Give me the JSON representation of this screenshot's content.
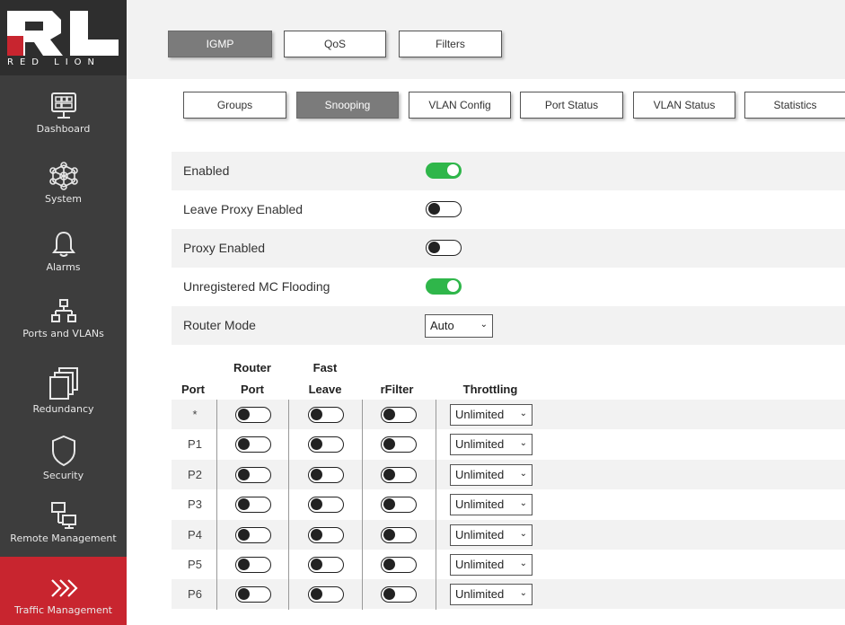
{
  "brand": {
    "logo_text": "RED LION",
    "logo_color": "#c8252f"
  },
  "sidebar": {
    "items": [
      {
        "label": "Dashboard",
        "icon": "dashboard-icon"
      },
      {
        "label": "System",
        "icon": "network-icon"
      },
      {
        "label": "Alarms",
        "icon": "bell-icon"
      },
      {
        "label": "Ports and VLANs",
        "icon": "ports-icon"
      },
      {
        "label": "Redundancy",
        "icon": "redundancy-icon"
      },
      {
        "label": "Security",
        "icon": "shield-icon"
      },
      {
        "label": "Remote Management",
        "icon": "remote-management-icon"
      },
      {
        "label": "Traffic Management",
        "icon": "chevrons-icon",
        "active": true
      }
    ]
  },
  "top_tabs": [
    {
      "label": "IGMP",
      "active": true
    },
    {
      "label": "QoS"
    },
    {
      "label": "Filters"
    }
  ],
  "sub_tabs": [
    {
      "label": "Groups"
    },
    {
      "label": "Snooping",
      "active": true
    },
    {
      "label": "VLAN Config"
    },
    {
      "label": "Port Status"
    },
    {
      "label": "VLAN Status"
    },
    {
      "label": "Statistics"
    }
  ],
  "settings": [
    {
      "label": "Enabled",
      "on": true
    },
    {
      "label": "Leave Proxy Enabled",
      "on": false
    },
    {
      "label": "Proxy Enabled",
      "on": false
    },
    {
      "label": "Unregistered MC Flooding",
      "on": true
    },
    {
      "label": "Router Mode",
      "value": "Auto"
    }
  ],
  "port_table": {
    "headers": {
      "port": "Port",
      "router_port_1": "Router",
      "router_port_2": "Port",
      "fast_leave_1": "Fast",
      "fast_leave_2": "Leave",
      "rfilter": "rFilter",
      "throttling": "Throttling"
    },
    "rows": [
      {
        "port": "*",
        "throttling": "Unlimited"
      },
      {
        "port": "P1",
        "throttling": "Unlimited"
      },
      {
        "port": "P2",
        "throttling": "Unlimited"
      },
      {
        "port": "P3",
        "throttling": "Unlimited"
      },
      {
        "port": "P4",
        "throttling": "Unlimited"
      },
      {
        "port": "P5",
        "throttling": "Unlimited"
      },
      {
        "port": "P6",
        "throttling": "Unlimited"
      }
    ]
  },
  "colors": {
    "accent_red": "#c8252f",
    "toggle_on": "#2fb64a",
    "sidebar_bg": "#3d3d3d",
    "active_tab": "#7b7b7b"
  }
}
